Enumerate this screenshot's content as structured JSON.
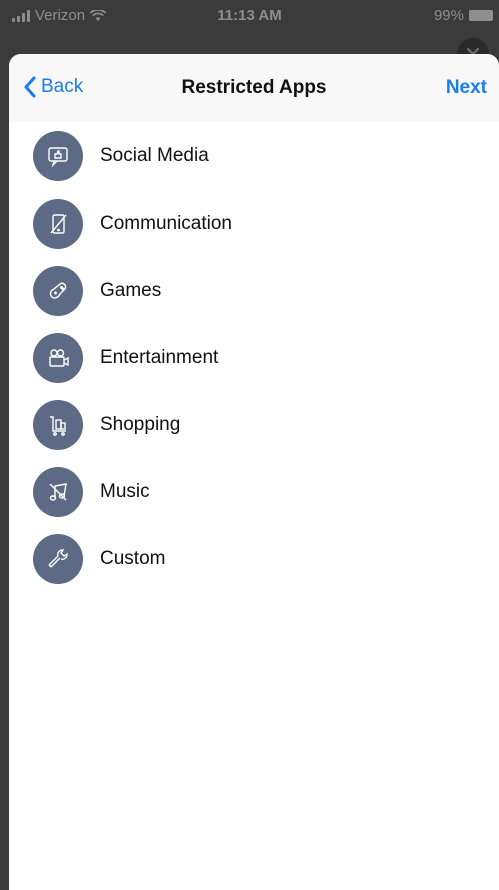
{
  "status_bar": {
    "carrier": "Verizon",
    "time": "11:13 AM",
    "battery": "99%"
  },
  "nav": {
    "back_label": "Back",
    "title": "Restricted Apps",
    "next_label": "Next"
  },
  "categories": [
    {
      "label": "Social Media",
      "icon": "social-media-icon"
    },
    {
      "label": "Communication",
      "icon": "communication-icon"
    },
    {
      "label": "Games",
      "icon": "games-icon"
    },
    {
      "label": "Entertainment",
      "icon": "entertainment-icon"
    },
    {
      "label": "Shopping",
      "icon": "shopping-icon"
    },
    {
      "label": "Music",
      "icon": "music-icon"
    },
    {
      "label": "Custom",
      "icon": "custom-icon"
    }
  ],
  "colors": {
    "accent": "#1a7cf5",
    "icon_bg": "#5d6a85",
    "nav_bg": "#f8f8f8"
  }
}
